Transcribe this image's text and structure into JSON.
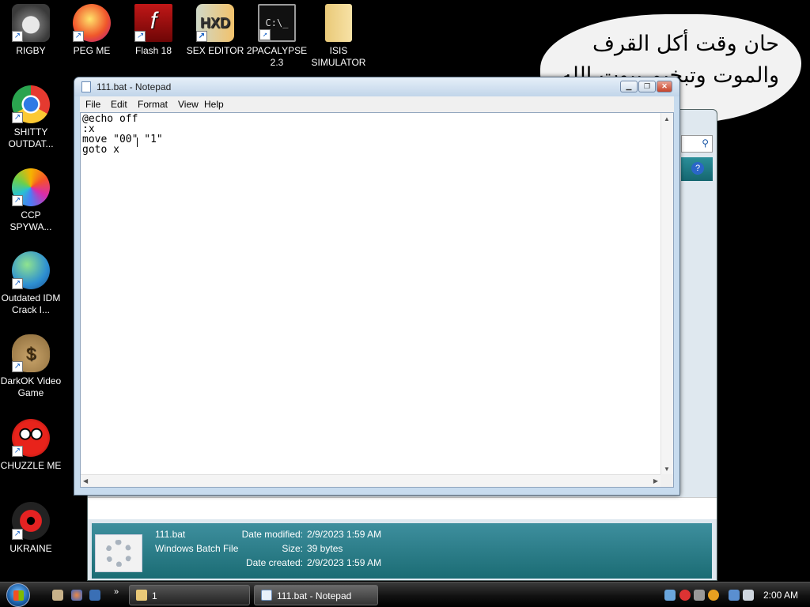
{
  "desktop_icons": [
    {
      "label": "RIGBY",
      "icon": "raccoon-icon"
    },
    {
      "label": "PEG ME",
      "icon": "peg-icon"
    },
    {
      "label": "Flash 18",
      "icon": "flash-icon"
    },
    {
      "label": "SEX EDITOR",
      "icon": "hex-editor-icon"
    },
    {
      "label": "2PACALYPSE 2.3",
      "icon": "terminal-icon"
    },
    {
      "label": "ISIS SIMULATOR",
      "icon": "folder-icon"
    },
    {
      "label": "SHITTY OUTDAT...",
      "icon": "chrome-icon"
    },
    {
      "label": "CCP SPYWA...",
      "icon": "pinwheel-icon"
    },
    {
      "label": "Outdated IDM Crack I...",
      "icon": "globe-download-icon"
    },
    {
      "label": "DarkOK Video Game",
      "icon": "money-bag-icon"
    },
    {
      "label": "CHUZZLE ME",
      "icon": "chuzzle-icon"
    },
    {
      "label": "UKRAINE",
      "icon": "radiation-icon"
    }
  ],
  "bubble_text": "حان وقت أكل القرف\nوالموت وتبخيم بيوت الله",
  "notepad": {
    "title": "111.bat - Notepad",
    "menu": [
      "File",
      "Edit",
      "Format",
      "View",
      "Help"
    ],
    "content": "@echo off\n:x\nmove \"00\" \"1\"\ngoto x"
  },
  "explorer_details": {
    "file_name": "111.bat",
    "file_type": "Windows Batch File",
    "modified_label": "Date modified:",
    "modified_value": "2/9/2023 1:59 AM",
    "size_label": "Size:",
    "size_value": "39 bytes",
    "created_label": "Date created:",
    "created_value": "2/9/2023 1:59 AM"
  },
  "taskbar": {
    "buttons": [
      {
        "label": "1",
        "icon": "folder-icon"
      },
      {
        "label": "111.bat - Notepad",
        "icon": "notepad-icon"
      }
    ],
    "clock": "2:00 AM"
  },
  "colors": {
    "desktop_bg": "#000000",
    "details_pane": "#2a7e88",
    "title_bar": "#c7dbee"
  }
}
